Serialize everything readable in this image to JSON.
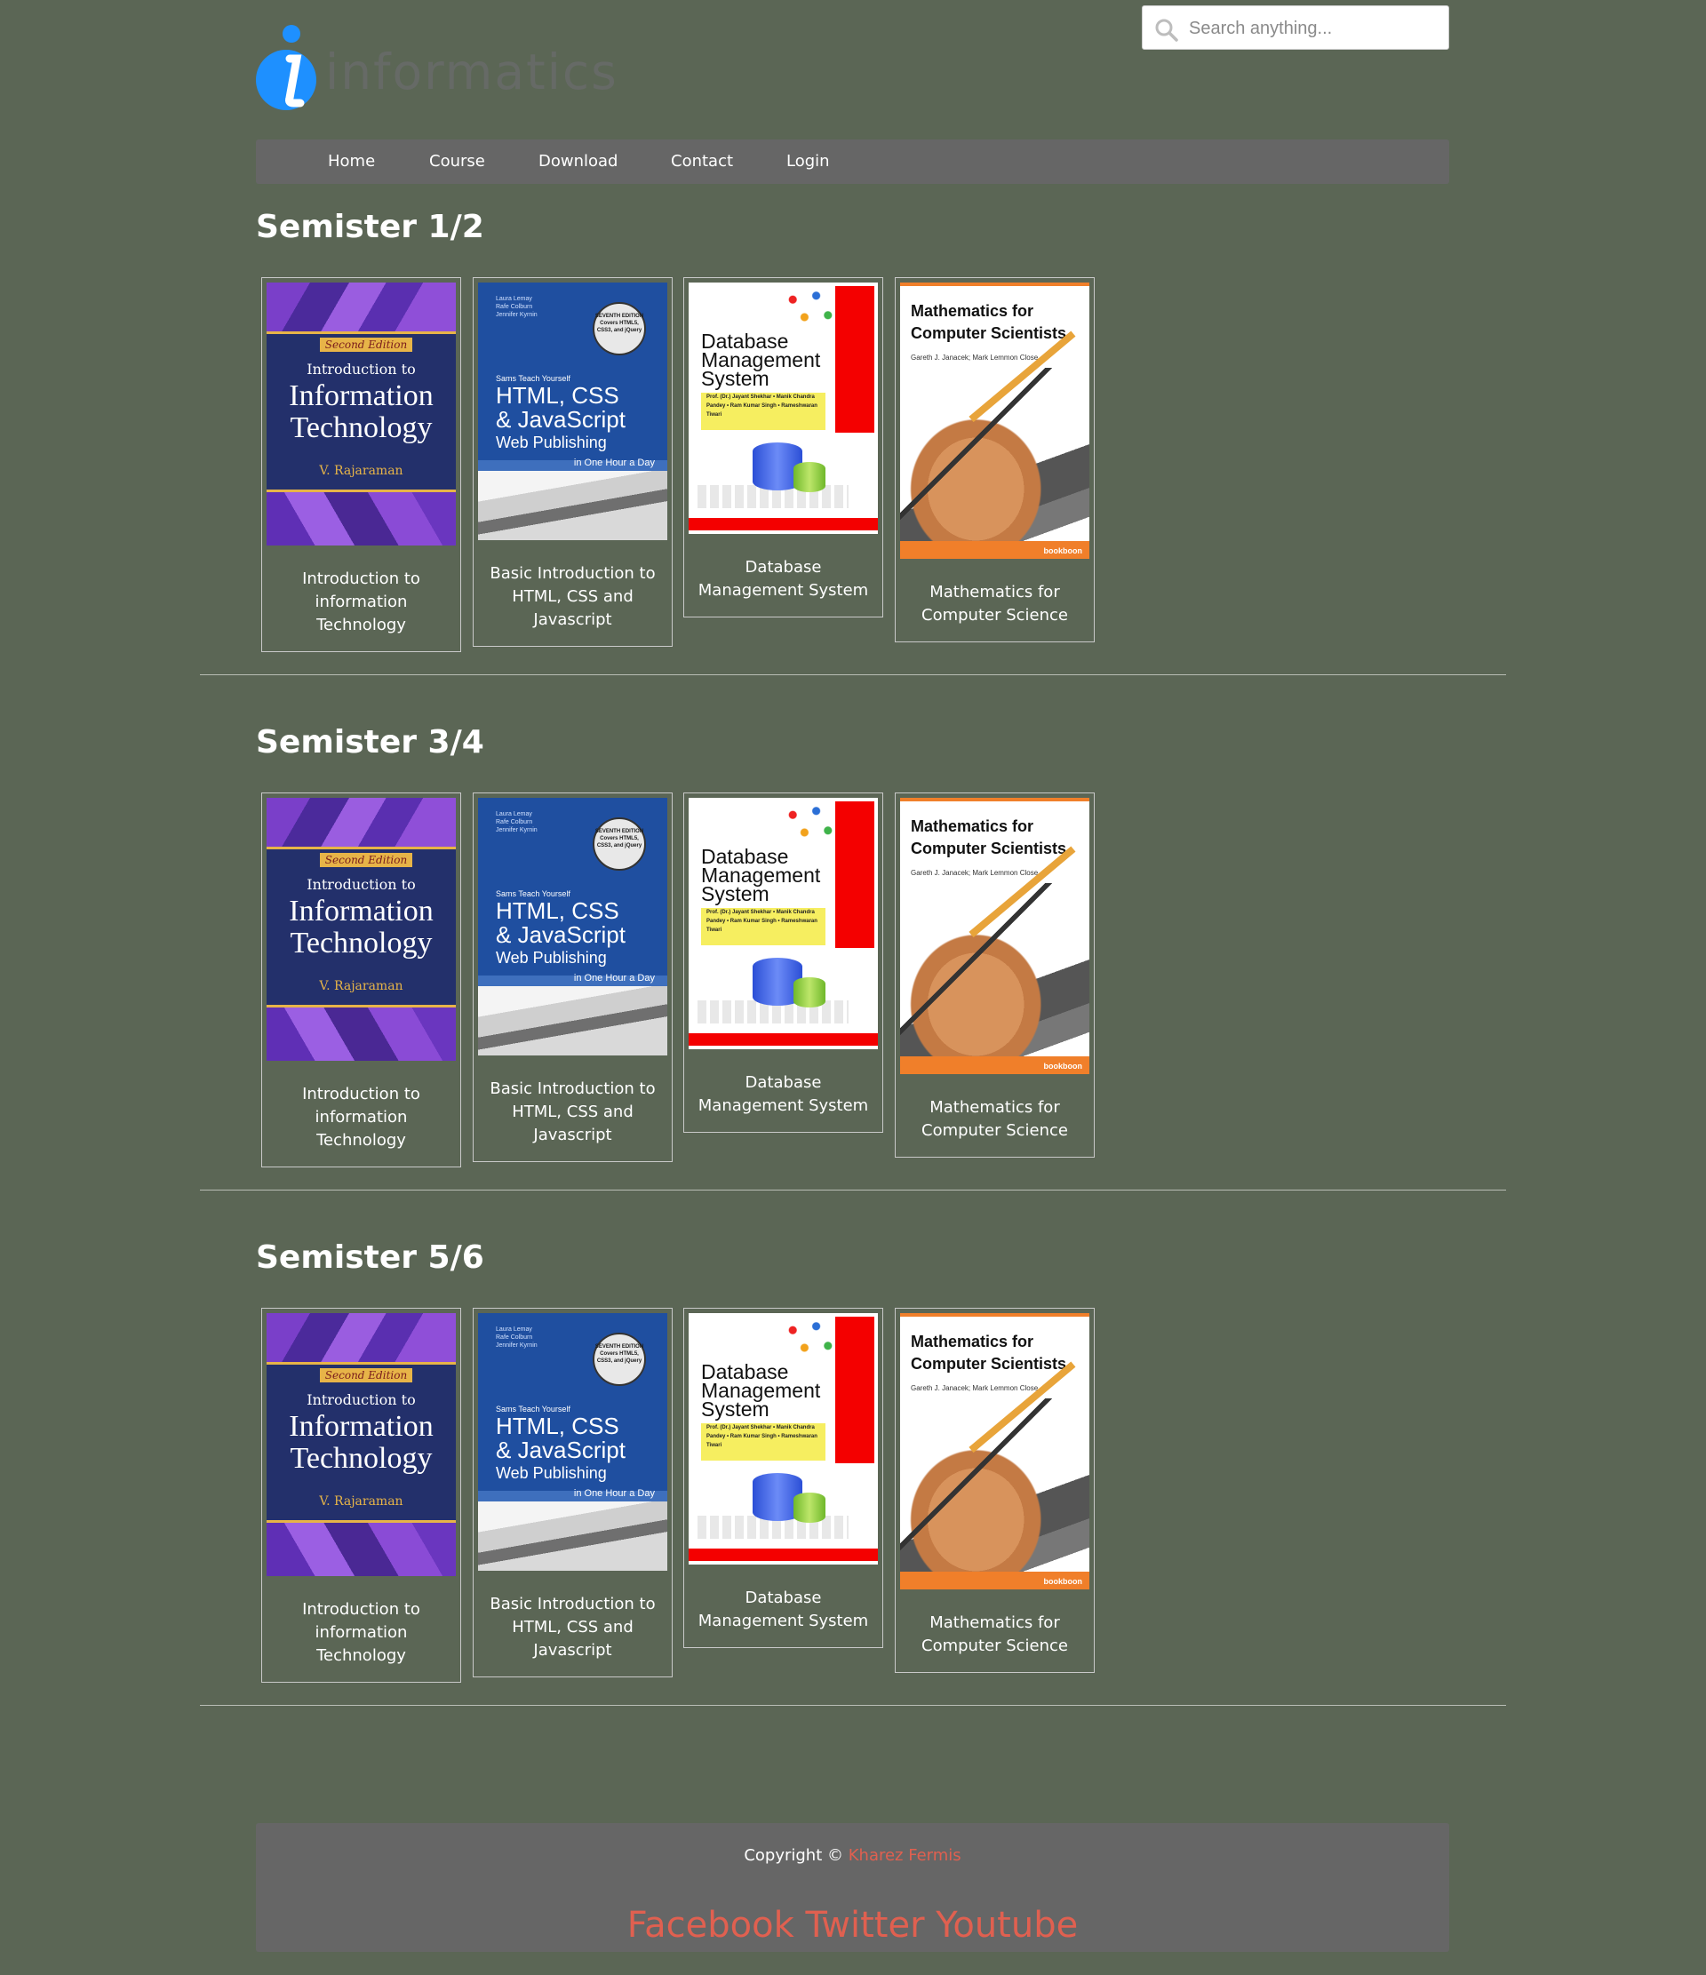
{
  "brand": {
    "name": "informatics"
  },
  "search": {
    "placeholder": "Search anything..."
  },
  "nav": {
    "items": [
      {
        "label": "Home"
      },
      {
        "label": "Course"
      },
      {
        "label": "Download"
      },
      {
        "label": "Contact"
      },
      {
        "label": "Login"
      }
    ]
  },
  "books": {
    "it": {
      "edition": "Second Edition",
      "line1": "Introduction to",
      "line2a": "Information",
      "line2b": "Technology",
      "author": "V. Rajaraman",
      "caption": "Introduction to information Technology"
    },
    "html": {
      "authors": "Laura Lemay\nRafe Colburn\nJennifer Kyrnin",
      "badge": "SEVENTH EDITION Covers HTML5, CSS3, and jQuery",
      "sams": "Sams Teach Yourself",
      "title1": "HTML, CSS",
      "title2": "& JavaScript",
      "sub": "Web Publishing",
      "hour": "in One Hour a Day",
      "caption": "Basic Introduction to HTML, CSS and Javascript"
    },
    "db": {
      "title1": "Database",
      "title2": "Management",
      "title3": "System",
      "authors": "Prof. (Dr.) Jayant Shekhar • Manik Chandra Pandey • Ram Kumar Singh • Rameshwaran Tiwari",
      "caption": "Database Management System"
    },
    "math": {
      "title1": "Mathematics for",
      "title2": "Computer Scientists",
      "author": "Gareth J. Janacek; Mark Lemmon Close",
      "publisher": "bookboon",
      "caption": "Mathematics for Computer Science"
    }
  },
  "sections": [
    {
      "title": "Semister 1/2"
    },
    {
      "title": "Semister 3/4"
    },
    {
      "title": "Semister 5/6"
    }
  ],
  "footer": {
    "copyright": "Copyright ©",
    "author": "Kharez Fermis",
    "social": [
      "Facebook",
      "Twitter",
      "Youtube"
    ]
  },
  "colors": {
    "background": "#5b6655",
    "nav": "#666666",
    "logo": "#1e90ff",
    "link": "#e06050"
  }
}
